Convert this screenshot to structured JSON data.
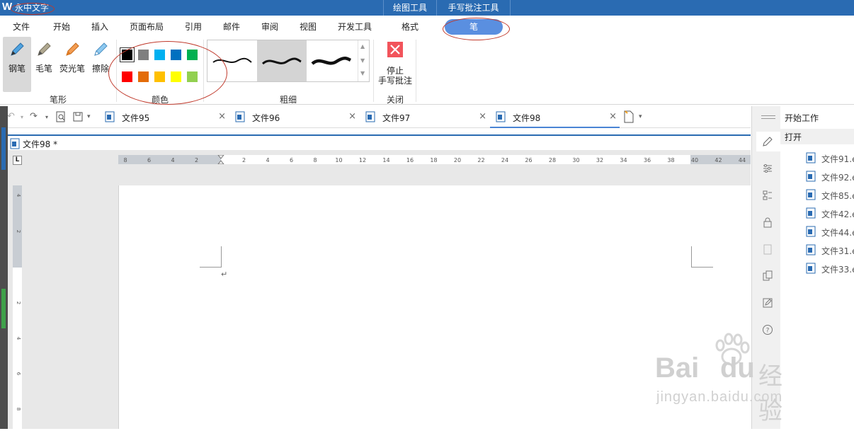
{
  "window": {
    "title": "永中文字",
    "logo": "W"
  },
  "context_tabs": [
    "绘图工具",
    "手写批注工具"
  ],
  "menu": {
    "tabs": [
      "文件",
      "开始",
      "插入",
      "页面布局",
      "引用",
      "邮件",
      "审阅",
      "视图",
      "开发工具",
      "格式"
    ],
    "active": "笔"
  },
  "ribbon": {
    "pen_group": {
      "label": "笔形",
      "tools": [
        "钢笔",
        "毛笔",
        "荧光笔",
        "擦除"
      ]
    },
    "color_group": {
      "label": "颜色",
      "colors": [
        "#000000",
        "#7f7f7f",
        "#00b0f0",
        "#0070c0",
        "#00b050",
        "#ff0000",
        "#e36c09",
        "#ffc000",
        "#ffff00",
        "#92d050"
      ]
    },
    "thickness_group": {
      "label": "粗细"
    },
    "close_group": {
      "label": "关闭",
      "stop_line1": "停止",
      "stop_line2": "手写批注"
    }
  },
  "doc_tabs": [
    {
      "label": "文件95"
    },
    {
      "label": "文件96"
    },
    {
      "label": "文件97"
    },
    {
      "label": "文件98"
    }
  ],
  "current_doc": "文件98 *",
  "ruler": {
    "h_ticks": [
      "8",
      "6",
      "4",
      "2",
      "2",
      "4",
      "6",
      "8",
      "10",
      "12",
      "14",
      "16",
      "18",
      "20",
      "22",
      "24",
      "26",
      "28",
      "30",
      "32",
      "34",
      "36",
      "38",
      "40",
      "42",
      "44"
    ],
    "v_ticks": [
      "4",
      "2",
      "2",
      "4",
      "6",
      "8"
    ]
  },
  "paragraph_mark": "↵",
  "right_panel": {
    "title": "开始工作",
    "section": "打开",
    "recent_files": [
      "文件91.e",
      "文件92.e",
      "文件85.e",
      "文件42.e",
      "文件44.e",
      "文件31.e",
      "文件33.e"
    ]
  },
  "watermark": {
    "brand_left": "Bai",
    "brand_right": "du",
    "brand_cn": "经验",
    "url": "jingyan.baidu.com"
  },
  "accent": "#2a6bb2",
  "annotation_color": "#c0392b"
}
